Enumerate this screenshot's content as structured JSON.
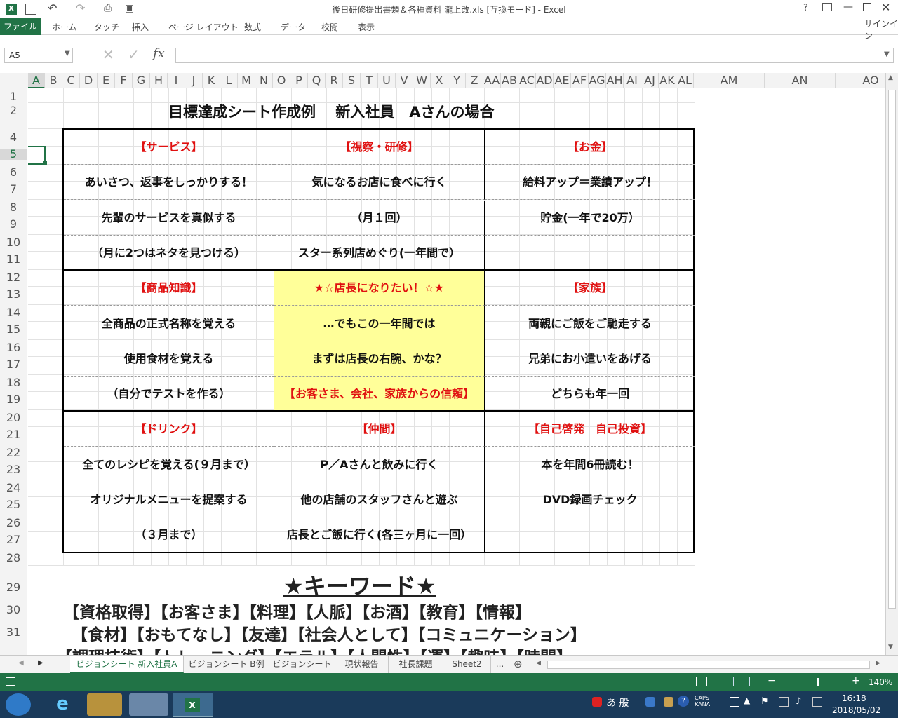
{
  "window": {
    "title": "後日研修提出書類＆各種資料  瀧上改.xls  [互換モード] - Excel",
    "signin": "サインイン",
    "help": "?"
  },
  "ribbon": {
    "file": "ファイル",
    "tabs": [
      "ホーム",
      "タッチ",
      "挿入",
      "ページ レイアウト",
      "数式",
      "データ",
      "校閲",
      "表示"
    ]
  },
  "formula_bar": {
    "name_box": "A5",
    "fx": "fx",
    "value": ""
  },
  "columns": [
    "A",
    "B",
    "C",
    "D",
    "E",
    "F",
    "G",
    "H",
    "I",
    "J",
    "K",
    "L",
    "M",
    "N",
    "O",
    "P",
    "Q",
    "R",
    "S",
    "T",
    "U",
    "V",
    "W",
    "X",
    "Y",
    "Z",
    "AA",
    "AB",
    "AC",
    "AD",
    "AE",
    "AF",
    "AG",
    "AH",
    "AI",
    "AJ",
    "AK",
    "AL",
    "AM",
    "AN",
    "AO"
  ],
  "rows": [
    "1",
    "2",
    "4",
    "5",
    "6",
    "7",
    "8",
    "9",
    "10",
    "11",
    "12",
    "13",
    "14",
    "15",
    "16",
    "17",
    "18",
    "19",
    "20",
    "21",
    "22",
    "23",
    "24",
    "25",
    "26",
    "27",
    "28",
    "29",
    "30",
    "31"
  ],
  "sheet": {
    "title": "目標達成シート作成例　 新入社員　Aさんの場合",
    "table": [
      [
        "【サービス】",
        "【視察・研修】",
        "【お金】"
      ],
      [
        "あいさつ、返事をしっかりする！",
        "気になるお店に食べに行く",
        "給料アップ＝業績アップ！"
      ],
      [
        "先輩のサービスを真似する",
        "（月１回）",
        "貯金(一年で20万）"
      ],
      [
        "（月に2つはネタを見つける）",
        "スター系列店めぐり(一年間で）",
        ""
      ],
      [
        "【商品知識】",
        "★☆店長になりたい！☆★",
        "【家族】"
      ],
      [
        "全商品の正式名称を覚える",
        "…でもこの一年間では",
        "両親にご飯をご馳走する"
      ],
      [
        "使用食材を覚える",
        "まずは店長の右腕、かな？",
        "兄弟にお小遣いをあげる"
      ],
      [
        "（自分でテストを作る）",
        "【お客さま、会社、家族からの信頼】",
        "どちらも年一回"
      ],
      [
        "【ドリンク】",
        "【仲間】",
        "【自己啓発　自己投資】"
      ],
      [
        "全てのレシピを覚える(９月まで）",
        "P／Aさんと飲みに行く",
        "本を年間6冊読む！"
      ],
      [
        "オリジナルメニューを提案する",
        "他の店舗のスタッフさんと遊ぶ",
        "DVD録画チェック"
      ],
      [
        "（３月まで）",
        "店長とご飯に行く(各三ヶ月に一回）",
        ""
      ]
    ],
    "keyword_title": "★キーワード★",
    "keywords": [
      "【資格取得】【お客さま】【料理】【人脈】【お酒】【教育】【情報】",
      "【食材】【おもてなし】【友達】【社会人として】【コミュニケーション】",
      "【調理技術】【トレーニング】【エラル】【人間性】【運】【趣味】【時間】"
    ]
  },
  "sheet_tabs": [
    "ビジョンシート 新入社員A",
    "ビジョンシート B例",
    "ビジョンシート",
    "現状報告",
    "社長課題",
    "Sheet2",
    "..."
  ],
  "status": {
    "zoom": "140%"
  },
  "taskbar": {
    "time": "16:18",
    "date": "2018/05/02",
    "ime": "あ 般"
  },
  "colors": {
    "accent": "#217346",
    "red_text": "#e01010",
    "highlight": "#ffff99"
  }
}
